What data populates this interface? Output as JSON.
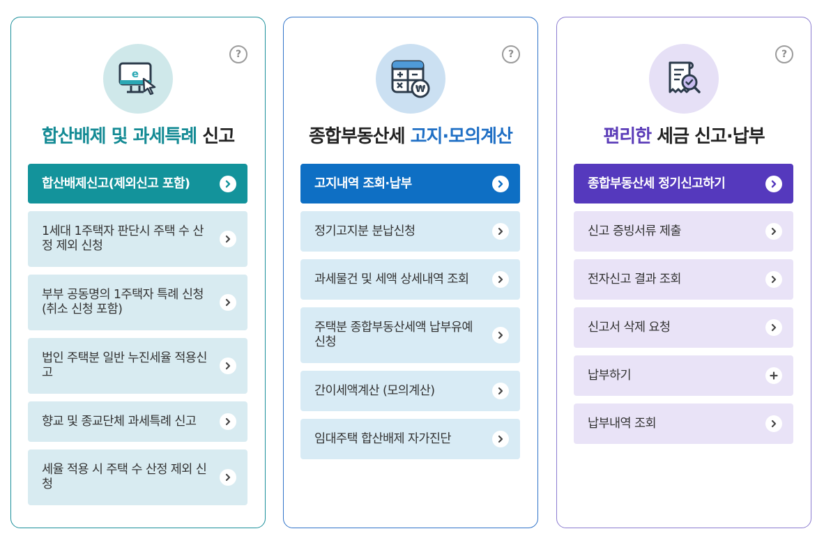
{
  "cards": [
    {
      "title_hl": "합산배제 및 과세특례",
      "title_rest": " 신고",
      "primary": "합산배제신고(제외신고 포함)",
      "items": [
        "1세대 1주택자 판단시 주택 수 산정 제외 신청",
        "부부 공동명의 1주택자 특례 신청(취소 신청 포함)",
        "법인 주택분 일반 누진세율 적용신고",
        "향교 및 종교단체 과세특례 신고",
        "세율 적용 시 주택 수 산정 제외 신청"
      ]
    },
    {
      "title_rest": "종합부동산세 ",
      "title_hl": "고지·모의계산",
      "primary": "고지내역 조회·납부",
      "items": [
        "정기고지분 분납신청",
        "과세물건 및 세액 상세내역 조회",
        "주택분 종합부동산세액 납부유예 신청",
        "간이세액계산 (모의계산)",
        "임대주택 합산배제 자가진단"
      ]
    },
    {
      "title_hl": "편리한",
      "title_rest": " 세금 신고·납부",
      "primary": "종합부동산세 정기신고하기",
      "items": [
        "신고 증빙서류 제출",
        "전자신고 결과 조회",
        "신고서 삭제 요청",
        "납부하기",
        "납부내역 조회"
      ]
    }
  ],
  "help_label": "?",
  "icons": [
    "e-filing-monitor-icon",
    "calculator-won-icon",
    "receipt-search-icon"
  ]
}
